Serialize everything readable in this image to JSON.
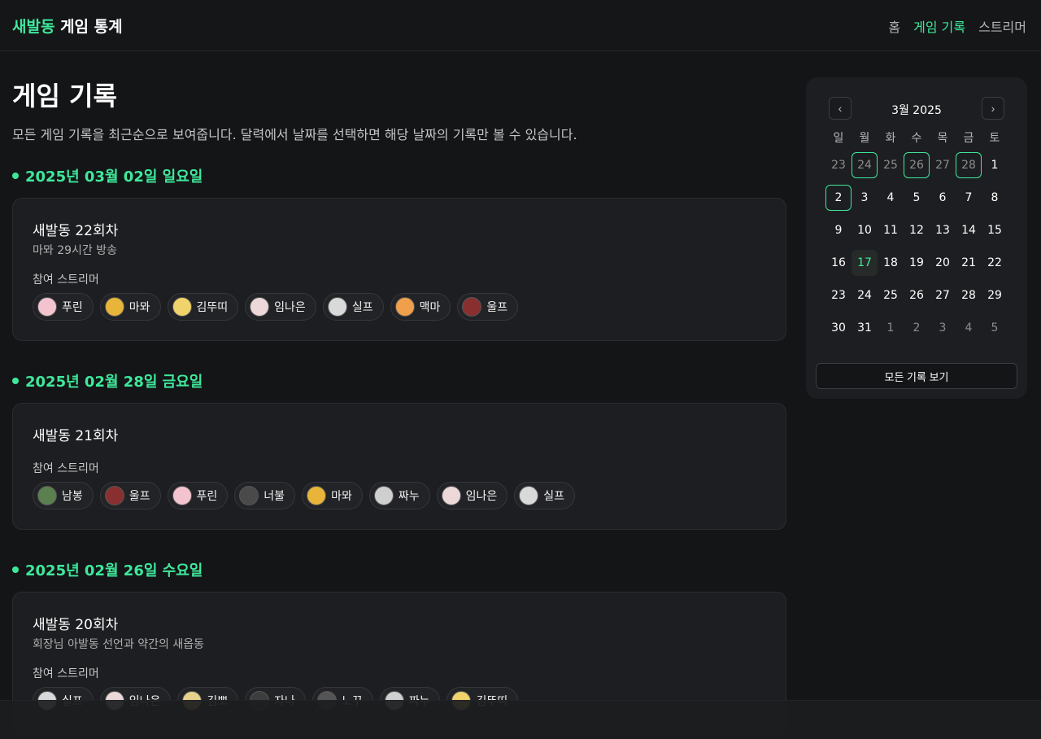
{
  "header": {
    "brand_accent": "새발동",
    "brand_rest": " 게임 통계",
    "nav": [
      "홈",
      "게임 기록",
      "스트리머"
    ]
  },
  "page": {
    "title": "게임 기록",
    "description": "모든 게임 기록을 최근순으로 보여줍니다. 달력에서 날짜를 선택하면 해당 날짜의 기록만 볼 수 있습니다.",
    "participants_label": "참여 스트리머"
  },
  "games": [
    {
      "date": "2025년 03월 02일 일요일",
      "title": "새발동 22회차",
      "subtitle": "마뫄 29시간 방송",
      "streamers": [
        "푸린",
        "마뫄",
        "김뚜띠",
        "임나은",
        "실프",
        "맥마",
        "울프"
      ]
    },
    {
      "date": "2025년 02월 28일 금요일",
      "title": "새발동 21회차",
      "subtitle": "",
      "streamers": [
        "남봉",
        "울프",
        "푸린",
        "너불",
        "마뫄",
        "짜누",
        "임나은",
        "실프"
      ]
    },
    {
      "date": "2025년 02월 26일 수요일",
      "title": "새발동 20회차",
      "subtitle": "회장님 아발동 선언과 약간의 새옵동",
      "streamers": [
        "실프",
        "임나은",
        "김뽀",
        "자나",
        "노꾸",
        "짜누",
        "김뚜띠"
      ]
    }
  ],
  "calendar": {
    "month_label": "3월 2025",
    "prev_icon": "chevron-left-icon",
    "next_icon": "chevron-right-icon",
    "weekdays": [
      "일",
      "월",
      "화",
      "수",
      "목",
      "금",
      "토"
    ],
    "weeks": [
      [
        "23",
        "24",
        "25",
        "26",
        "27",
        "28",
        "1"
      ],
      [
        "2",
        "3",
        "4",
        "5",
        "6",
        "7",
        "8"
      ],
      [
        "9",
        "10",
        "11",
        "12",
        "13",
        "14",
        "15"
      ],
      [
        "16",
        "17",
        "18",
        "19",
        "20",
        "21",
        "22"
      ],
      [
        "23",
        "24",
        "25",
        "26",
        "27",
        "28",
        "29"
      ],
      [
        "30",
        "31",
        "1",
        "2",
        "3",
        "4",
        "5"
      ]
    ],
    "show_all_label": "모든 기록 보기"
  },
  "colors": {
    "accent": "#3ee89b",
    "background": "#141517",
    "card": "#1d1e21"
  }
}
